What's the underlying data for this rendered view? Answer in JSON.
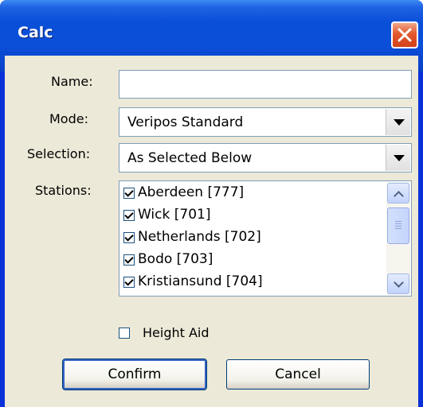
{
  "window": {
    "title": "Calc"
  },
  "form": {
    "name_label": "Name:",
    "name_value": "",
    "mode_label": "Mode:",
    "mode_value": "Veripos Standard",
    "selection_label": "Selection:",
    "selection_value": "As Selected Below",
    "stations_label": "Stations:",
    "stations": [
      {
        "label": "Aberdeen [777]",
        "checked": true
      },
      {
        "label": "Wick [701]",
        "checked": true
      },
      {
        "label": "Netherlands [702]",
        "checked": true
      },
      {
        "label": "Bodo [703]",
        "checked": true
      },
      {
        "label": "Kristiansund [704]",
        "checked": true
      }
    ],
    "height_aid_label": "Height Aid",
    "height_aid_checked": false
  },
  "buttons": {
    "confirm_label": "Confirm",
    "cancel_label": "Cancel"
  },
  "icons": {
    "close": "close-icon",
    "dropdown": "chevron-down-icon",
    "scroll_up": "chevron-up-icon",
    "scroll_down": "chevron-down-icon"
  },
  "colors": {
    "titlebar": "#0a4fd8",
    "close_button": "#e2582b",
    "dialog_bg": "#ece9d8"
  }
}
